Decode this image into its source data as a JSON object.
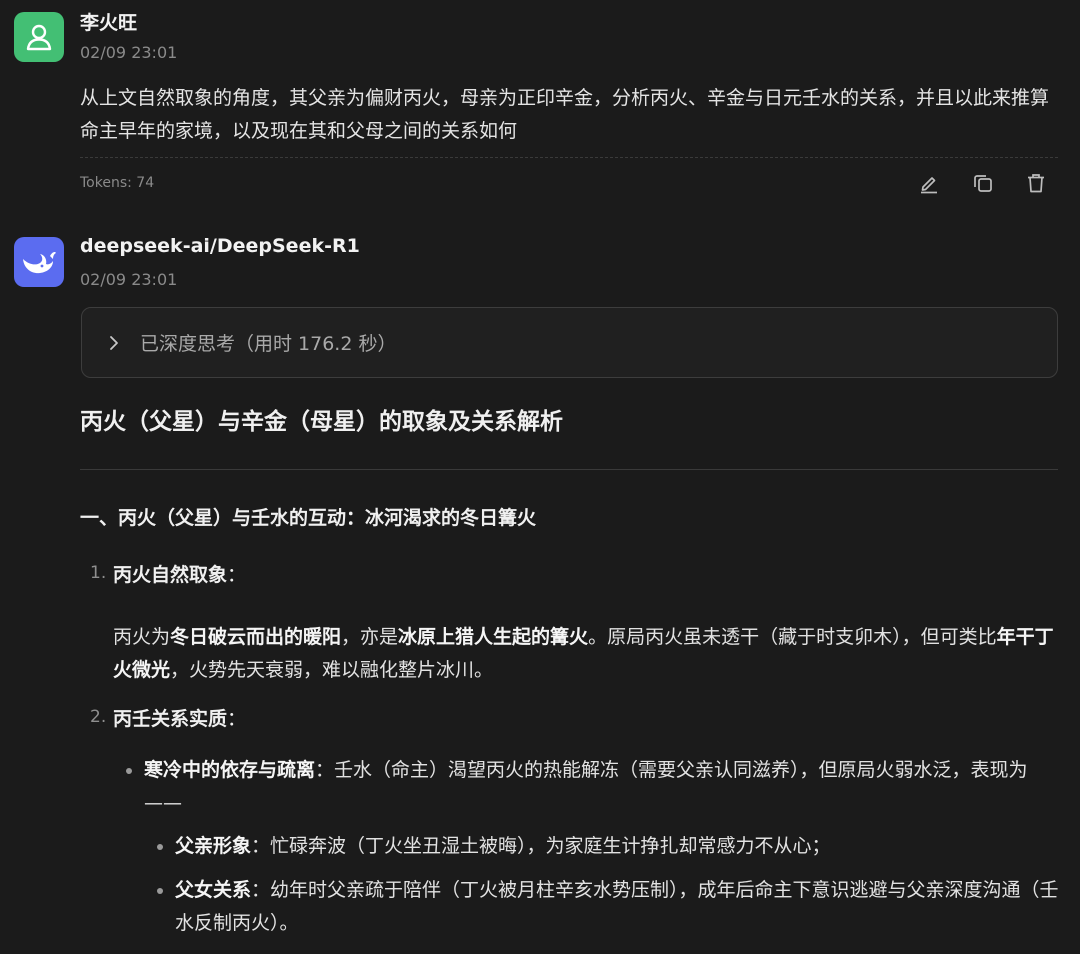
{
  "user_message": {
    "name": "李火旺",
    "time": "02/09 23:01",
    "text": "从上文自然取象的角度，其父亲为偏财丙火，母亲为正印辛金，分析丙火、辛金与日元壬水的关系，并且以此来推算命主早年的家境，以及现在其和父母之间的关系如何",
    "tokens": "Tokens: 74",
    "actions": [
      "edit-icon",
      "copy-icon",
      "delete-icon"
    ]
  },
  "bot_message": {
    "name": "deepseek-ai/DeepSeek-R1",
    "time": "02/09 23:01",
    "thinking_label": "已深度思考（用时 176.2 秒）",
    "heading": "丙火（父星）与辛金（母星）的取象及关系解析",
    "section_title": "一、丙火（父星）与壬水的互动：冰河渴求的冬日篝火",
    "items": [
      {
        "number": "1.",
        "title": "丙火自然取象",
        "colon": "："
      },
      {
        "number": "2.",
        "title": "丙壬关系实质",
        "colon": "："
      }
    ],
    "para1": {
      "t1": "丙火为",
      "b1": "冬日破云而出的暖阳",
      "t2": "，亦是",
      "b2": "冰原上猎人生起的篝火",
      "t3": "。原局丙火虽未透干（藏于时支卯木），但可类比",
      "b3": "年干丁火微光",
      "t4": "，火势先天衰弱，难以融化整片冰川。"
    },
    "bullet1": {
      "b": "寒冷中的依存与疏离",
      "t": "：壬水（命主）渴望丙火的热能解冻（需要父亲认同滋养），但原局火弱水泛，表现为——"
    },
    "bullet2": {
      "b": "父亲形象",
      "t": "：忙碌奔波（丁火坐丑湿土被晦），为家庭生计挣扎却常感力不从心；"
    },
    "bullet3": {
      "b": "父女关系",
      "t": "：幼年时父亲疏于陪伴（丁火被月柱辛亥水势压制），成年后命主下意识逃避与父亲深度沟通（壬水反制丙火）。"
    }
  },
  "colors": {
    "background": "#1b1b1b",
    "user_avatar": "#43bf74",
    "bot_avatar": "#5b6cf0"
  }
}
